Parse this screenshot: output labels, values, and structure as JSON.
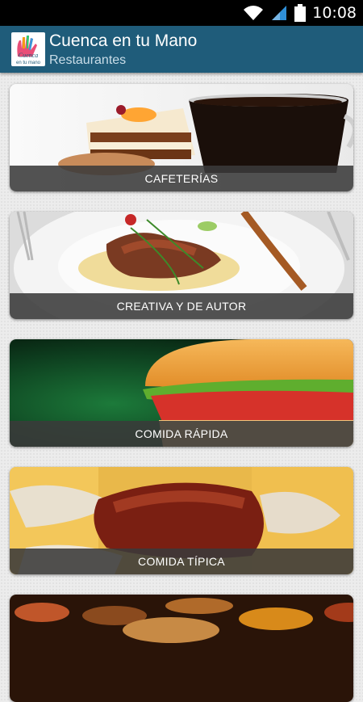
{
  "status_bar": {
    "time": "10:08",
    "icons": [
      "wifi-icon",
      "cell-signal-icon",
      "battery-icon"
    ]
  },
  "app_bar": {
    "title": "Cuenca en tu Mano",
    "subtitle": "Restaurantes",
    "logo_text": "Cuenca en tu mano",
    "color": "#1f5c7a"
  },
  "categories": [
    {
      "label": "CAFETERÍAS",
      "image": "coffee-and-cake"
    },
    {
      "label": "CREATIVA Y DE AUTOR",
      "image": "gourmet-plate"
    },
    {
      "label": "COMIDA RÁPIDA",
      "image": "burger"
    },
    {
      "label": "COMIDA TÍPICA",
      "image": "roast-pork"
    },
    {
      "label": "",
      "image": "spice-bowls"
    }
  ]
}
